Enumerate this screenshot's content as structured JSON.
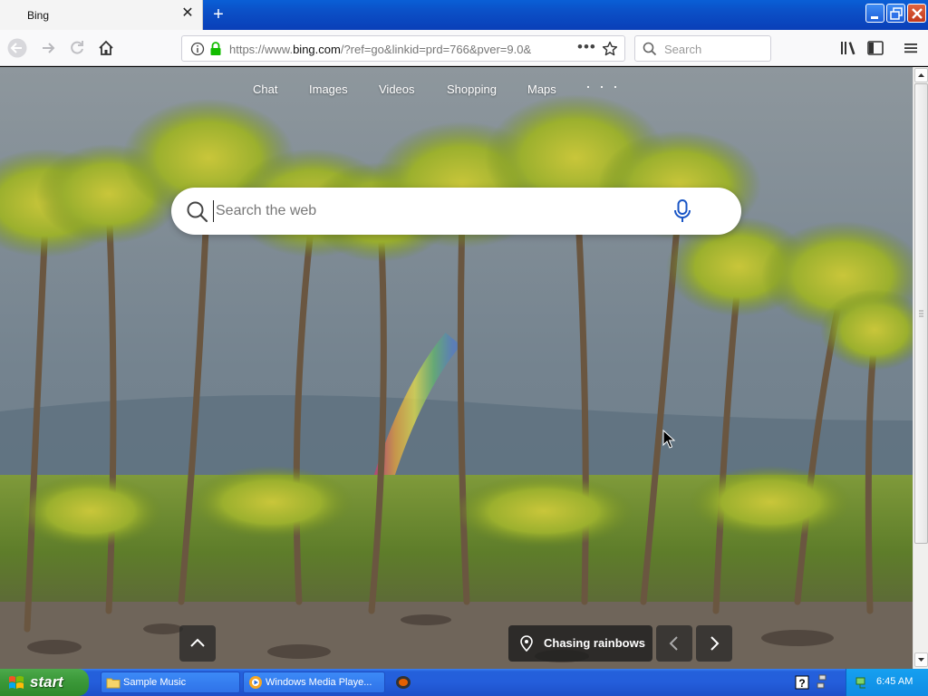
{
  "browser": {
    "tab": {
      "title": "Bing"
    },
    "url": {
      "domain_prefix": "https://www.",
      "domain": "bing.com",
      "path": "/?ref=go&linkid=prd=766&pver=9.0&"
    },
    "search_placeholder": "Search"
  },
  "bing": {
    "nav": [
      "Chat",
      "Images",
      "Videos",
      "Shopping",
      "Maps"
    ],
    "more": "· · ·",
    "search_placeholder": "Search the web",
    "caption": "Chasing rainbows"
  },
  "taskbar": {
    "start_label": "start",
    "tasks": [
      "Sample Music",
      "Windows Media Playe..."
    ],
    "clock": "6:45 AM"
  },
  "colors": {
    "xp_blue": "#245edb",
    "start_green": "#3c9a3a",
    "bing_mic_blue": "#1a56c5"
  }
}
